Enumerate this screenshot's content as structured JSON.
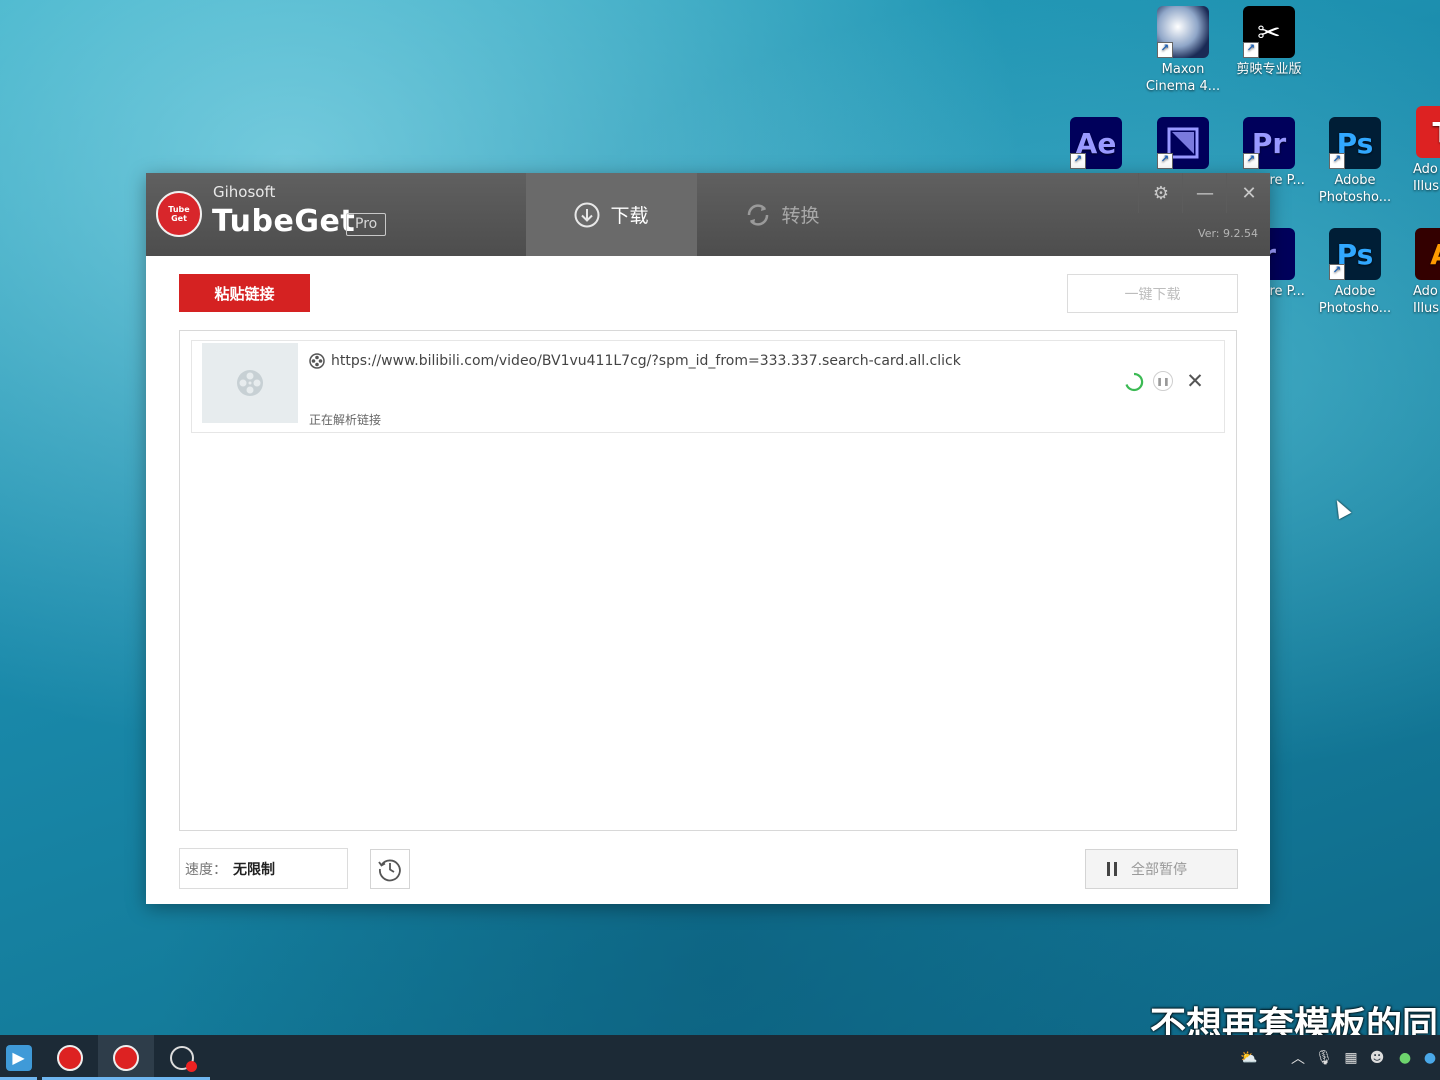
{
  "desktop": {
    "icons": [
      {
        "label": "Maxon Cinema 4...",
        "glyph": ""
      },
      {
        "label": "剪映专业版",
        "glyph": "✂"
      },
      {
        "label": "",
        "glyph": "Ae"
      },
      {
        "label": "",
        "glyph": ""
      },
      {
        "label": "obe ere P...",
        "glyph": "Pr"
      },
      {
        "label": "Adobe Photosho...",
        "glyph": "Ps"
      },
      {
        "label": "Ado Illus",
        "glyph": "T"
      },
      {
        "label": "obe ere P...",
        "glyph": "r"
      },
      {
        "label": "Adobe Photosho...",
        "glyph": "Ps"
      },
      {
        "label": "Ado Illus",
        "glyph": "A"
      }
    ]
  },
  "app": {
    "brand_small": "Gihosoft",
    "brand_name": "TubeGet",
    "badge": "Pro",
    "logo_top": "Tube",
    "logo_bottom": "Get",
    "tabs": [
      {
        "label": "下载",
        "active": true
      },
      {
        "label": "转换",
        "active": false
      }
    ],
    "version": "Ver: 9.2.54",
    "paste_button": "粘贴链接",
    "one_click_button": "一键下载",
    "items": [
      {
        "url": "https://www.bilibili.com/video/BV1vu411L7cg/?spm_id_from=333.337.search-card.all.click",
        "status": "正在解析链接"
      }
    ],
    "speed_label": "速度：",
    "speed_value": "无限制",
    "pause_all_button": "全部暂停"
  },
  "overlay_subtitle": "不想再套模板的同",
  "colors": {
    "accent_red": "#d52222",
    "titlebar": "#555555",
    "spinner": "#3cba54"
  }
}
